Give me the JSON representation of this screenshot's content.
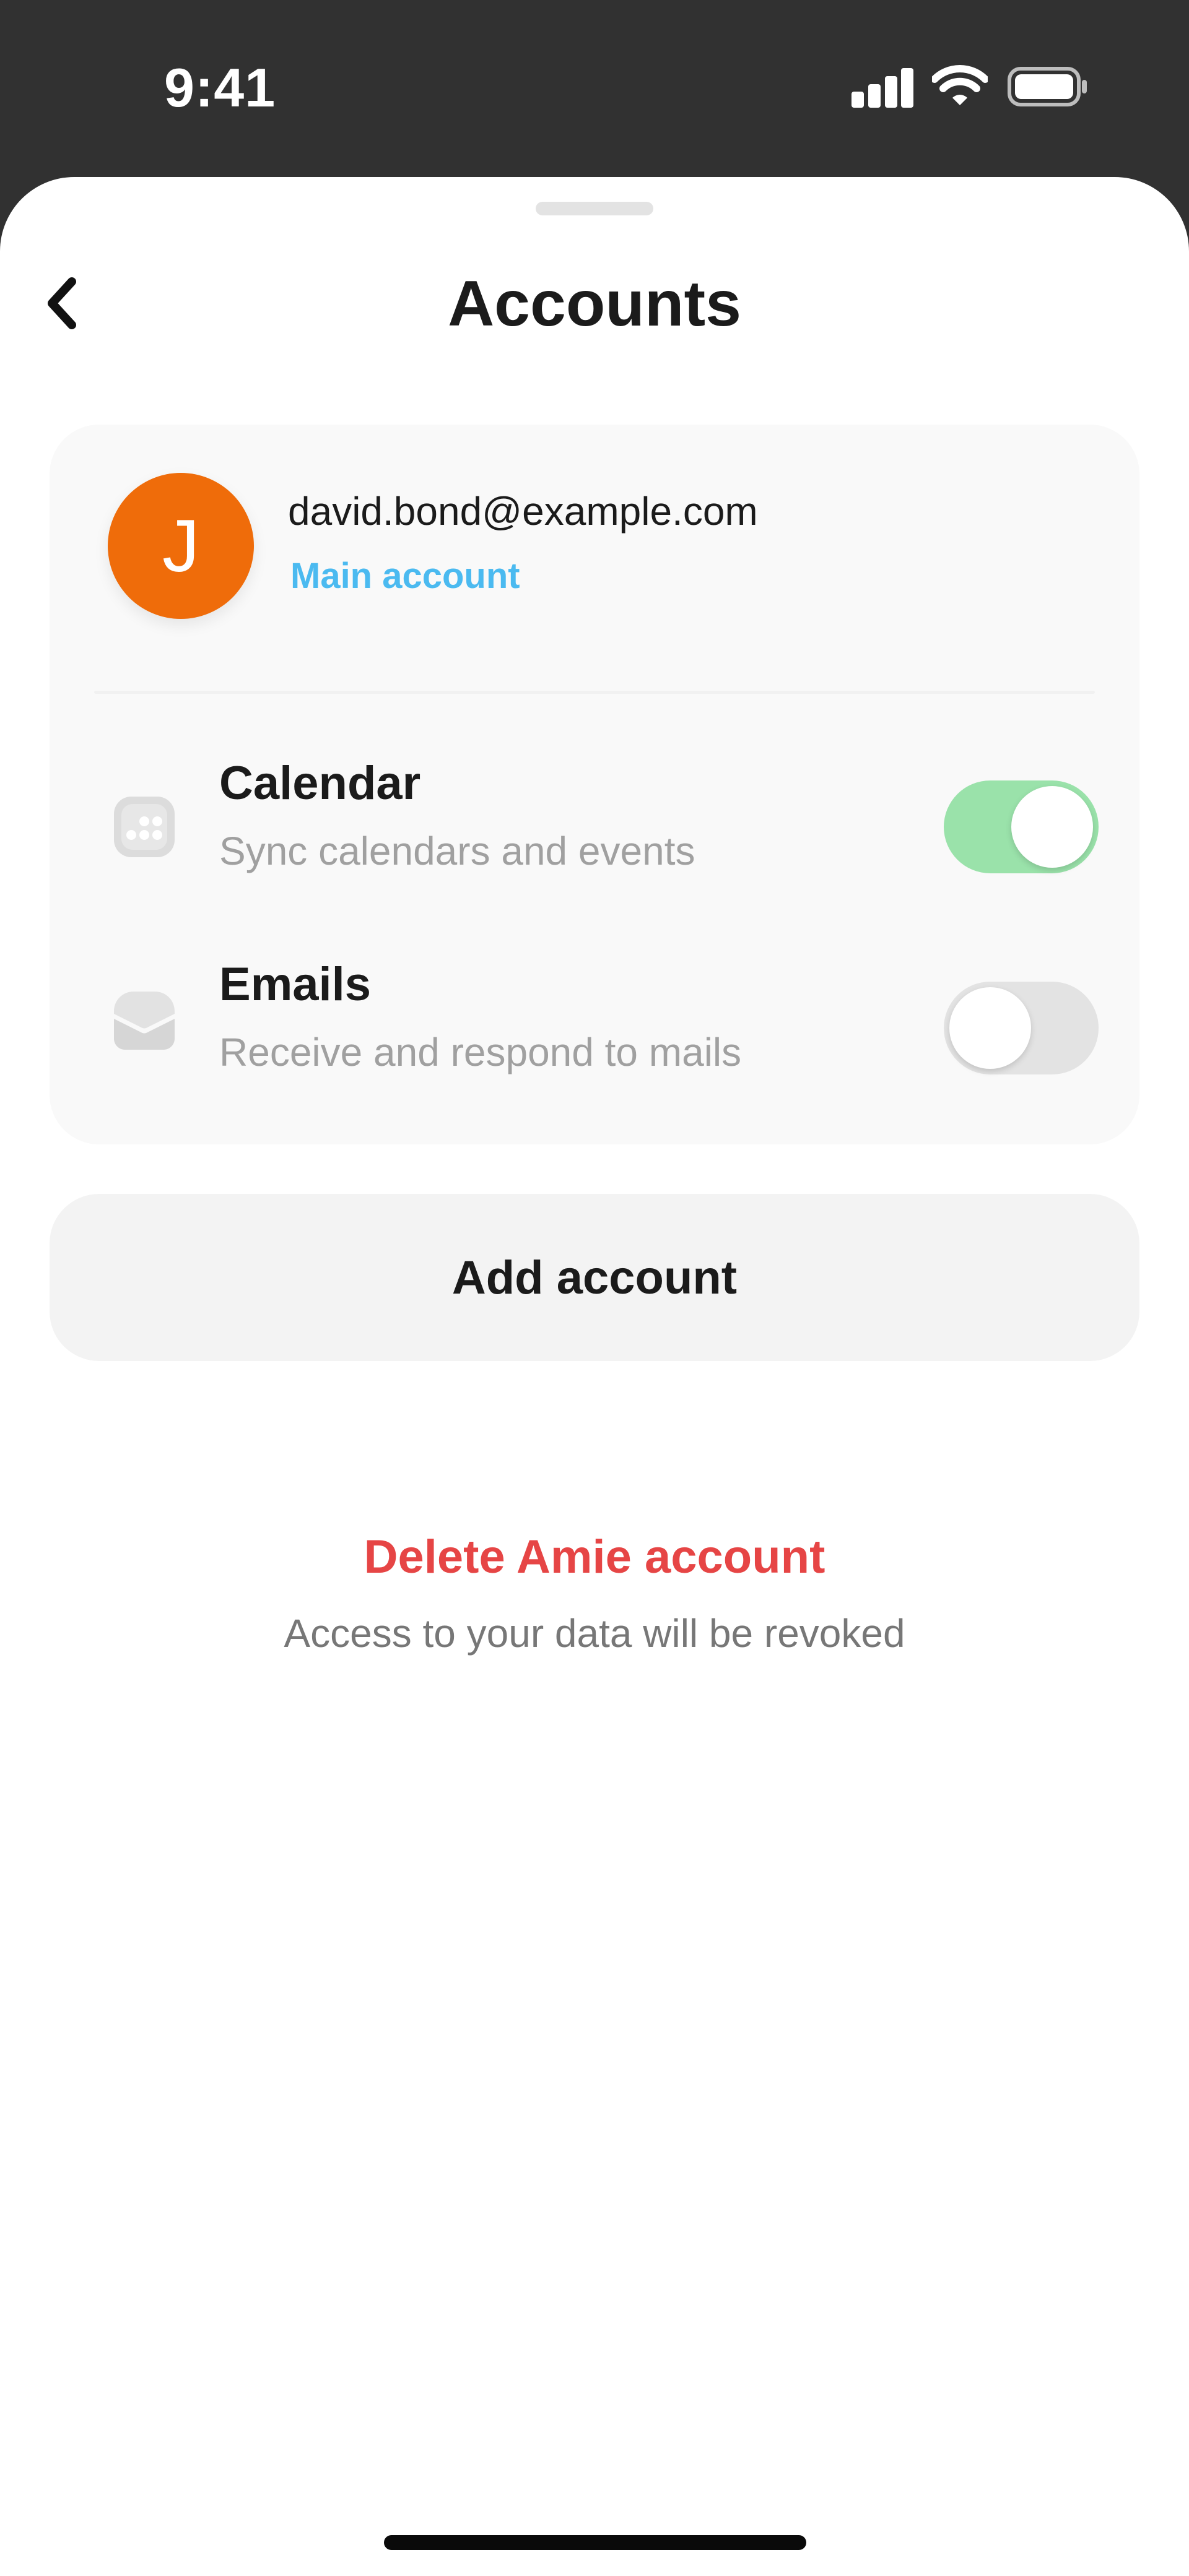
{
  "status_bar": {
    "time": "9:41",
    "signal_icon": "cellular-signal-icon",
    "wifi_icon": "wifi-icon",
    "battery_icon": "battery-icon"
  },
  "header": {
    "title": "Accounts",
    "back_icon": "chevron-left-icon"
  },
  "account": {
    "avatar_initial": "J",
    "email": "david.bond@example.com",
    "role": "Main account",
    "avatar_color": "#ef6c0a",
    "role_color": "#4bbaf0"
  },
  "services": [
    {
      "title": "Calendar",
      "description": "Sync calendars and events",
      "icon": "calendar-icon",
      "enabled": true
    },
    {
      "title": "Emails",
      "description": "Receive and respond to mails",
      "icon": "inbox-icon",
      "enabled": false
    }
  ],
  "actions": {
    "add_account": "Add account",
    "delete_account": "Delete Amie account",
    "delete_note": "Access to your data will be revoked"
  },
  "colors": {
    "toggle_on": "#9ae2aa",
    "toggle_off": "#e3e3e3",
    "danger": "#e64545"
  }
}
